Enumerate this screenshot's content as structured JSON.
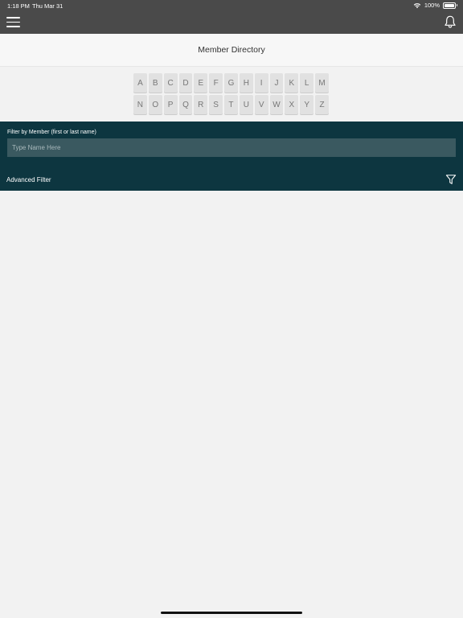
{
  "status_bar": {
    "time": "1:18 PM",
    "date": "Thu Mar 31",
    "battery": "100%"
  },
  "header": {
    "menu_icon": "hamburger-menu-icon",
    "notification_icon": "bell-icon"
  },
  "page": {
    "title": "Member Directory"
  },
  "alphabet": {
    "row1": [
      "A",
      "B",
      "C",
      "D",
      "E",
      "F",
      "G",
      "H",
      "I",
      "J",
      "K",
      "L",
      "M"
    ],
    "row2": [
      "N",
      "O",
      "P",
      "Q",
      "R",
      "S",
      "T",
      "U",
      "V",
      "W",
      "X",
      "Y",
      "Z"
    ]
  },
  "filter": {
    "label": "Filter by Member (first or last name)",
    "placeholder": "Type Name Here",
    "value": "",
    "advanced_label": "Advanced Filter",
    "advanced_icon": "funnel-icon"
  },
  "colors": {
    "header_bg": "#4a4a4a",
    "filter_panel_bg": "#0d3640",
    "input_bg": "#3a5960",
    "page_bg": "#f2f2f2"
  }
}
